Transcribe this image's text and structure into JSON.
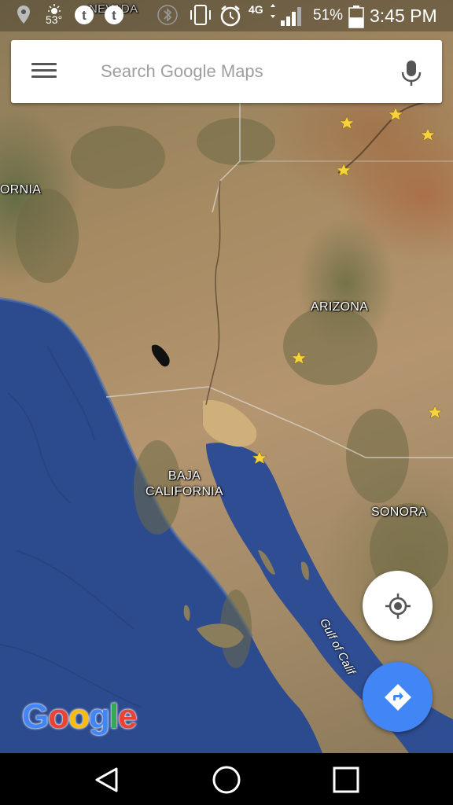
{
  "status_bar": {
    "icons": [
      "location-pin-icon",
      "weather-sun-icon",
      "tumblr-icon",
      "tumblr-icon",
      "bluetooth-icon",
      "vibrate-icon",
      "alarm-icon",
      "network-4g-icon",
      "signal-icon",
      "battery-icon"
    ],
    "temperature": "53°",
    "network_type": "4G",
    "battery_percent": "51%",
    "battery_level": 0.51,
    "time": "3:45 PM"
  },
  "search": {
    "placeholder": "Search Google Maps",
    "value": "",
    "menu_icon": "hamburger-menu-icon",
    "mic_icon": "microphone-icon"
  },
  "map": {
    "labels": {
      "nevada": "NEVADA",
      "california": "ORNIA",
      "arizona": "ARIZONA",
      "baja_california": "BAJA\nCALIFORNIA",
      "sonora": "SONORA",
      "gulf": "Gulf of Calif"
    },
    "marker_icon": "star-marker-icon",
    "colors": {
      "ocean": "#2d4a8f",
      "land": "#a88c65",
      "marker": "#f6d23b"
    }
  },
  "buttons": {
    "my_location_icon": "my-location-icon",
    "directions_icon": "directions-icon",
    "directions_color": "#4285f4"
  },
  "logo": {
    "text": "Google",
    "colors": [
      "#4285f4",
      "#ea4335",
      "#fbbc05",
      "#4285f4",
      "#34a853",
      "#ea4335"
    ]
  },
  "nav_bar": {
    "icons": [
      "back-triangle-icon",
      "home-circle-icon",
      "recents-square-icon"
    ]
  }
}
